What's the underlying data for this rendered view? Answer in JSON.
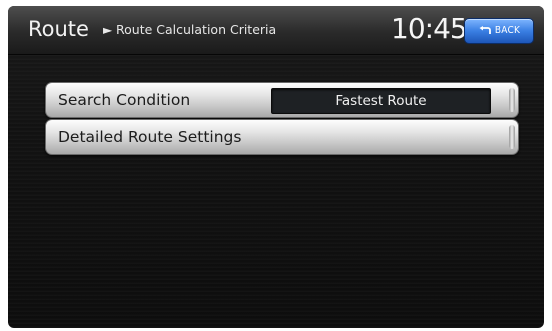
{
  "header": {
    "title": "Route",
    "breadcrumb_arrow": "►",
    "subtitle": "Route Calculation Criteria",
    "clock": "10:45",
    "back_label": "BACK",
    "back_icon": "back-arrow-icon",
    "back_color": "#3a7fe3"
  },
  "menu": {
    "items": [
      {
        "label": "Search Condition",
        "value": "Fastest Route"
      },
      {
        "label": "Detailed Route Settings"
      }
    ]
  }
}
